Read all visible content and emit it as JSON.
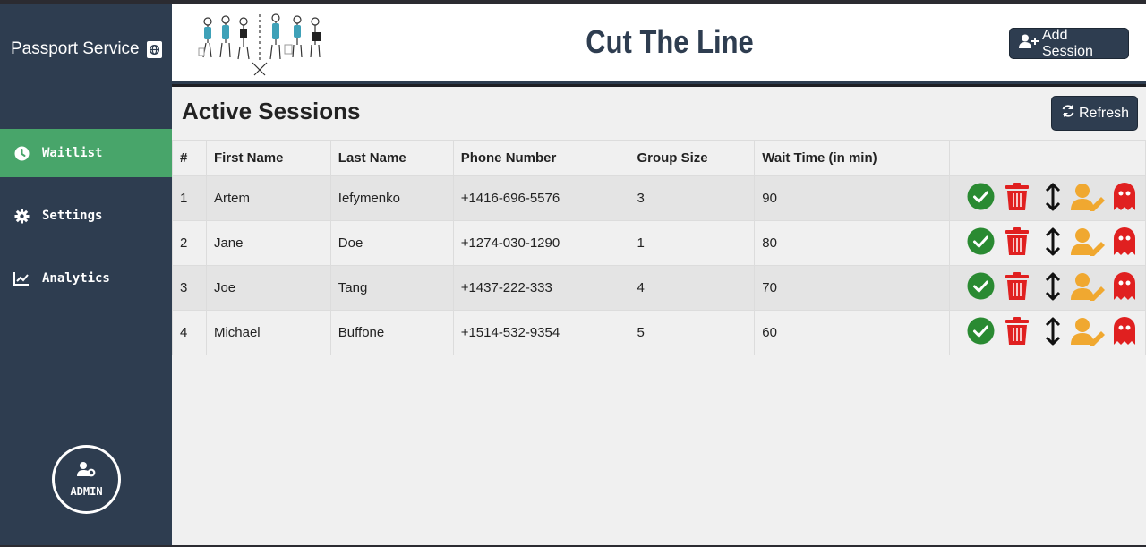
{
  "sidebar": {
    "brand": "Passport Service",
    "items": [
      {
        "label": "Waitlist",
        "icon": "clock-icon",
        "active": true
      },
      {
        "label": "Settings",
        "icon": "gear-icon",
        "active": false
      },
      {
        "label": "Analytics",
        "icon": "line-chart-icon",
        "active": false
      }
    ],
    "admin_label": "ADMIN"
  },
  "header": {
    "title": "Cut The Line",
    "add_session_label": "Add Session"
  },
  "main": {
    "title": "Active Sessions",
    "refresh_label": "Refresh",
    "columns": [
      "#",
      "First Name",
      "Last Name",
      "Phone Number",
      "Group Size",
      "Wait Time (in min)",
      ""
    ],
    "rows": [
      {
        "num": "1",
        "first": "Artem",
        "last": "Iefymenko",
        "phone": "+1416-696-5576",
        "group": "3",
        "wait": "90"
      },
      {
        "num": "2",
        "first": "Jane",
        "last": "Doe",
        "phone": "+1274-030-1290",
        "group": "1",
        "wait": "80"
      },
      {
        "num": "3",
        "first": "Joe",
        "last": "Tang",
        "phone": "+1437-222-333",
        "group": "4",
        "wait": "70"
      },
      {
        "num": "4",
        "first": "Michael",
        "last": "Buffone",
        "phone": "+1514-532-9354",
        "group": "5",
        "wait": "60"
      }
    ]
  },
  "colors": {
    "sidebar": "#2e3d50",
    "active": "#48a56a",
    "check": "#2a8a32",
    "trash": "#e02020",
    "edit": "#f0a830",
    "ghost": "#e02020"
  }
}
